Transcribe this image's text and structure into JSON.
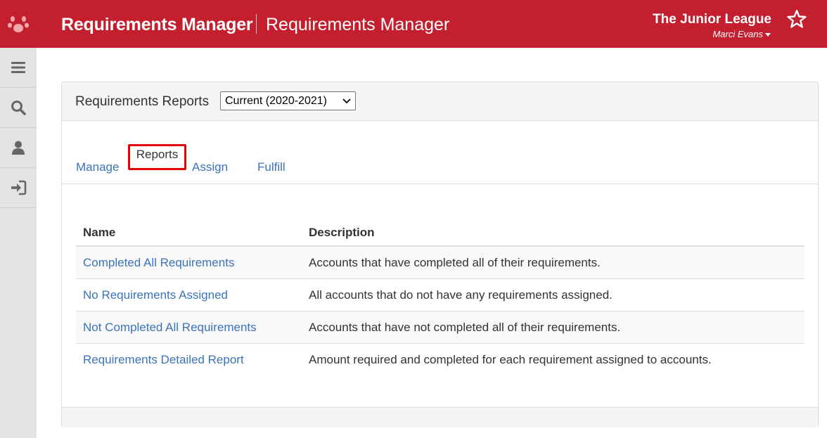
{
  "header": {
    "app_title": "Requirements Manager",
    "page_title": "Requirements Manager",
    "org_name": "The Junior League",
    "user_name": "Marci Evans",
    "brand_color": "#c41f2e"
  },
  "sidebar": {
    "items": [
      {
        "icon": "menu-icon"
      },
      {
        "icon": "search-icon"
      },
      {
        "icon": "user-icon"
      },
      {
        "icon": "sign-out-icon"
      }
    ]
  },
  "panel": {
    "title": "Requirements Reports",
    "year_select": {
      "selected": "Current (2020-2021)"
    },
    "tabs": [
      {
        "label": "Manage"
      },
      {
        "label": "Reports",
        "active": true
      },
      {
        "label": "Assign"
      },
      {
        "label": "Fulfill"
      }
    ],
    "table": {
      "columns": [
        "Name",
        "Description"
      ],
      "rows": [
        {
          "name": "Completed All Requirements",
          "description": "Accounts that have completed all of their requirements."
        },
        {
          "name": "No Requirements Assigned",
          "description": "All accounts that do not have any requirements assigned."
        },
        {
          "name": "Not Completed All Requirements",
          "description": "Accounts that have not completed all of their requirements."
        },
        {
          "name": "Requirements Detailed Report",
          "description": "Amount required and completed for each requirement assigned to accounts."
        }
      ]
    }
  }
}
